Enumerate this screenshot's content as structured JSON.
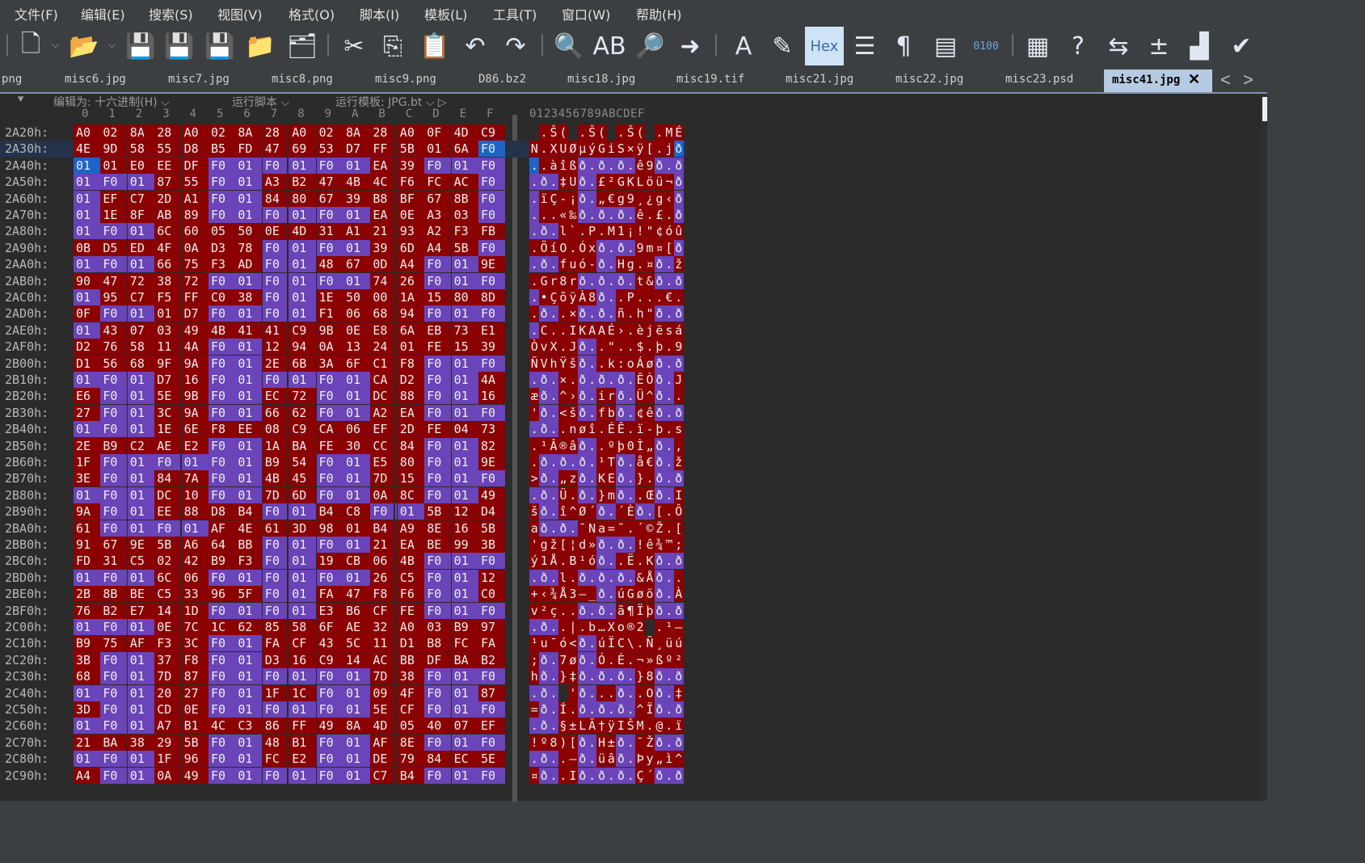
{
  "menu": [
    "文件(F)",
    "编辑(E)",
    "搜索(S)",
    "视图(V)",
    "格式(O)",
    "脚本(I)",
    "模板(L)",
    "工具(T)",
    "窗口(W)",
    "帮助(H)"
  ],
  "toolbar": [
    {
      "name": "new-file-icon",
      "glyph": "🗋"
    },
    {
      "name": "open-folder-icon",
      "glyph": "📂"
    },
    {
      "name": "save-icon",
      "glyph": "💾"
    },
    {
      "name": "save-as-icon",
      "glyph": "💾"
    },
    {
      "name": "save-all-icon",
      "glyph": "💾"
    },
    {
      "name": "folder-icon",
      "glyph": "📁"
    },
    {
      "name": "open-multiple-icon",
      "glyph": "🗂"
    },
    {
      "name": "cut-icon",
      "glyph": "✂"
    },
    {
      "name": "copy-icon",
      "glyph": "⎘"
    },
    {
      "name": "paste-icon",
      "glyph": "📋"
    },
    {
      "name": "undo-icon",
      "glyph": "↶"
    },
    {
      "name": "redo-icon",
      "glyph": "↷"
    },
    {
      "name": "find-icon",
      "glyph": "🔍"
    },
    {
      "name": "replace-icon",
      "glyph": "AB"
    },
    {
      "name": "find-in-files-icon",
      "glyph": "🔎"
    },
    {
      "name": "goto-icon",
      "glyph": "➜"
    },
    {
      "name": "font-icon",
      "glyph": "A"
    },
    {
      "name": "highlight-icon",
      "glyph": "✎"
    },
    {
      "name": "hex-mode-button",
      "glyph": "Hex"
    },
    {
      "name": "edit-mode-icon",
      "glyph": "☰"
    },
    {
      "name": "show-whitespace-icon",
      "glyph": "¶"
    },
    {
      "name": "columns-icon",
      "glyph": "▤"
    },
    {
      "name": "binary-icon",
      "glyph": "0100"
    },
    {
      "name": "calculator-icon",
      "glyph": "▦"
    },
    {
      "name": "help-icon",
      "glyph": "?"
    },
    {
      "name": "compare-icon",
      "glyph": "⇆"
    },
    {
      "name": "add-subtract-icon",
      "glyph": "±"
    },
    {
      "name": "histogram-icon",
      "glyph": "▟"
    },
    {
      "name": "checksum-icon",
      "glyph": "✔"
    }
  ],
  "tabs": [
    "png",
    "misc6.jpg",
    "misc7.jpg",
    "misc8.png",
    "misc9.png",
    "D86.bz2",
    "misc18.jpg",
    "misc19.tif",
    "misc21.jpg",
    "misc22.jpg",
    "misc23.psd",
    "misc41.jpg"
  ],
  "active_tab": "misc41.jpg",
  "tab_close": "✕",
  "tab_nav": [
    "<",
    ">"
  ],
  "options": {
    "edit_as": "编辑为: 十六进制(H)",
    "run_script": "运行脚本",
    "run_template": "运行模板: JPG.bt"
  },
  "column_header": {
    "hex": [
      "0",
      "1",
      "2",
      "3",
      "4",
      "5",
      "6",
      "7",
      "8",
      "9",
      "A",
      "B",
      "C",
      "D",
      "E",
      "F"
    ],
    "ascii": "0123456789ABCDEF"
  },
  "colors": {
    "red": "#8b0000",
    "purple": "#6a44b8",
    "selected": "#1e64c8"
  },
  "rows": [
    {
      "addr": "2A20h:",
      "hex": [
        "A0",
        "02",
        "8A",
        "28",
        "A0",
        "02",
        "8A",
        "28",
        "A0",
        "02",
        "8A",
        "28",
        "A0",
        "0F",
        "4D",
        "C9"
      ],
      "asc": " .Š( .Š( .Š( .MÉ",
      "c": "RRRRRRRRRRRRRRRR",
      "ac": "RRRRRRRRRRRRRRRR"
    },
    {
      "addr": "2A30h:",
      "hex": [
        "4E",
        "9D",
        "58",
        "55",
        "D8",
        "B5",
        "FD",
        "47",
        "69",
        "53",
        "D7",
        "FF",
        "5B",
        "01",
        "6A",
        "F0"
      ],
      "asc": "N.XUØµýGiS×ÿ[.jð",
      "c": "RRRRRRRRRRRRRRRS",
      "ac": "RRRRRRRRRRRRRRRS"
    },
    {
      "addr": "2A40h:",
      "hex": [
        "01",
        "01",
        "E0",
        "EE",
        "DF",
        "F0",
        "01",
        "F0",
        "01",
        "F0",
        "01",
        "EA",
        "39",
        "F0",
        "01",
        "F0"
      ],
      "asc": "..àîßð.ð.ð.ê9ð.ð",
      "c": "SRRRRPPPPPPRRPPP",
      "ac": "SRRRRPPPPPPRRPPP"
    },
    {
      "addr": "2A50h:",
      "hex": [
        "01",
        "F0",
        "01",
        "87",
        "55",
        "F0",
        "01",
        "A3",
        "B2",
        "47",
        "4B",
        "4C",
        "F6",
        "FC",
        "AC",
        "F0"
      ],
      "asc": ".ð.‡Uð.£²GKLöü¬ð",
      "c": "PPPRRPPRRRRRRRRP",
      "ac": "PPPRRPPRRRRRRRRP"
    },
    {
      "addr": "2A60h:",
      "hex": [
        "01",
        "EF",
        "C7",
        "2D",
        "A1",
        "F0",
        "01",
        "84",
        "80",
        "67",
        "39",
        "B8",
        "BF",
        "67",
        "8B",
        "F0"
      ],
      "asc": ".ïÇ-¡ð.„€g9¸¿g‹ð",
      "c": "PRRRRPPRRRRRRRRP",
      "ac": "PRRRRPPRRRRRRRRP"
    },
    {
      "addr": "2A70h:",
      "hex": [
        "01",
        "1E",
        "8F",
        "AB",
        "89",
        "F0",
        "01",
        "F0",
        "01",
        "F0",
        "01",
        "EA",
        "0E",
        "A3",
        "03",
        "F0"
      ],
      "asc": "...«‰ð.ð.ð.ê.£.ð",
      "c": "PRRRRPPPPPPRRRRP",
      "ac": "PRRRRPPPPPPRRRRP"
    },
    {
      "addr": "2A80h:",
      "hex": [
        "01",
        "F0",
        "01",
        "6C",
        "60",
        "05",
        "50",
        "0E",
        "4D",
        "31",
        "A1",
        "21",
        "93",
        "A2",
        "F3",
        "FB"
      ],
      "asc": ".ð.l`.P.M1¡!\"¢óû",
      "c": "PPPRRRRRRRRRRRRR",
      "ac": "PPPRRRRRRRRRRRRR"
    },
    {
      "addr": "2A90h:",
      "hex": [
        "0B",
        "D5",
        "ED",
        "4F",
        "0A",
        "D3",
        "78",
        "F0",
        "01",
        "F0",
        "01",
        "39",
        "6D",
        "A4",
        "5B",
        "F0"
      ],
      "asc": ".ÕíO.Óxð.ð.9m¤[ð",
      "c": "RRRRRRRPPPPRRRRP",
      "ac": "RRRRRRRPPPPRRRRP"
    },
    {
      "addr": "2AA0h:",
      "hex": [
        "01",
        "F0",
        "01",
        "66",
        "75",
        "F3",
        "AD",
        "F0",
        "01",
        "48",
        "67",
        "0D",
        "A4",
        "F0",
        "01",
        "9E"
      ],
      "asc": ".ð.fuó-ð.Hg.¤ð.ž",
      "c": "PPPRRRRPPRRRRPPR",
      "ac": "PPPRRRRPPRRRRPPR"
    },
    {
      "addr": "2AB0h:",
      "hex": [
        "90",
        "47",
        "72",
        "38",
        "72",
        "F0",
        "01",
        "F0",
        "01",
        "F0",
        "01",
        "74",
        "26",
        "F0",
        "01",
        "F0"
      ],
      "asc": ".Gr8rð.ð.ð.t&ð.ð",
      "c": "RRRRRPPPPPPRRPPP",
      "ac": "RRRRRPPPPPPRRPPP"
    },
    {
      "addr": "2AC0h:",
      "hex": [
        "01",
        "95",
        "C7",
        "F5",
        "FF",
        "C0",
        "38",
        "F0",
        "01",
        "1E",
        "50",
        "00",
        "1A",
        "15",
        "80",
        "8D"
      ],
      "asc": ".•ÇõÿÀ8ð..P...€.",
      "c": "PRRRRRRPPRRRRRRR",
      "ac": "PRRRRRRPPRRRRRRR"
    },
    {
      "addr": "2AD0h:",
      "hex": [
        "0F",
        "F0",
        "01",
        "01",
        "D7",
        "F0",
        "01",
        "F0",
        "01",
        "F1",
        "06",
        "68",
        "94",
        "F0",
        "01",
        "F0"
      ],
      "asc": ".ð..×ð.ð.ñ.h\"ð.ð",
      "c": "RPPRRPPPPRRRRPPP",
      "ac": "RPPRRPPPPRRRRPPP"
    },
    {
      "addr": "2AE0h:",
      "hex": [
        "01",
        "43",
        "07",
        "03",
        "49",
        "4B",
        "41",
        "41",
        "C9",
        "9B",
        "0E",
        "E8",
        "6A",
        "EB",
        "73",
        "E1"
      ],
      "asc": ".C..IKAAÉ›.èjësá",
      "c": "PRRRRRRRRRRRRRRR",
      "ac": "PRRRRRRRRRRRRRRR"
    },
    {
      "addr": "2AF0h:",
      "hex": [
        "D2",
        "76",
        "58",
        "11",
        "4A",
        "F0",
        "01",
        "12",
        "94",
        "0A",
        "13",
        "24",
        "01",
        "FE",
        "15",
        "39"
      ],
      "asc": "ÒvX.Jð..\"..$.þ.9",
      "c": "RRRRRPPRRRRRRRRR",
      "ac": "RRRRRPPRRRRRRRRR"
    },
    {
      "addr": "2B00h:",
      "hex": [
        "D1",
        "56",
        "68",
        "9F",
        "9A",
        "F0",
        "01",
        "2E",
        "6B",
        "3A",
        "6F",
        "C1",
        "F8",
        "F0",
        "01",
        "F0"
      ],
      "asc": "ÑVhŸšð..k:oÁøð.ð",
      "c": "RRRRRPPRRRRRRPPP",
      "ac": "RRRRRPPRRRRRRPPP"
    },
    {
      "addr": "2B10h:",
      "hex": [
        "01",
        "F0",
        "01",
        "D7",
        "16",
        "F0",
        "01",
        "F0",
        "01",
        "F0",
        "01",
        "CA",
        "D2",
        "F0",
        "01",
        "4A"
      ],
      "asc": ".ð.×.ð.ð.ð.ÊÒð.J",
      "c": "PPPRRPPPPPPRRPPR",
      "ac": "PPPRRPPPPPPRRPPR"
    },
    {
      "addr": "2B20h:",
      "hex": [
        "E6",
        "F0",
        "01",
        "5E",
        "9B",
        "F0",
        "01",
        "EC",
        "72",
        "F0",
        "01",
        "DC",
        "88",
        "F0",
        "01",
        "16"
      ],
      "asc": "æð.^›ð.irð.Ü^ð..",
      "c": "RPPRRPPRRPPRRPPR",
      "ac": "RPPRRPPRRPPRRPPR"
    },
    {
      "addr": "2B30h:",
      "hex": [
        "27",
        "F0",
        "01",
        "3C",
        "9A",
        "F0",
        "01",
        "66",
        "62",
        "F0",
        "01",
        "A2",
        "EA",
        "F0",
        "01",
        "F0"
      ],
      "asc": "'ð.<šð.fbð.¢êð.ð",
      "c": "RPPRRPPRRPPRRPPP",
      "ac": "RPPRRPPRRPPRRPPP"
    },
    {
      "addr": "2B40h:",
      "hex": [
        "01",
        "F0",
        "01",
        "1E",
        "6E",
        "F8",
        "EE",
        "08",
        "C9",
        "CA",
        "06",
        "EF",
        "2D",
        "FE",
        "04",
        "73"
      ],
      "asc": ".ð..nøî.ÉÊ.ï-þ.s",
      "c": "PPPRRRRRRRRRRRRR",
      "ac": "PPPRRRRRRRRRRRRR"
    },
    {
      "addr": "2B50h:",
      "hex": [
        "2E",
        "B9",
        "C2",
        "AE",
        "E2",
        "F0",
        "01",
        "1A",
        "BA",
        "FE",
        "30",
        "CC",
        "84",
        "F0",
        "01",
        "82"
      ],
      "asc": ".¹Â®âð..ºþ0Ì„ð.,",
      "c": "RRRRRPPRRRRRRPPR",
      "ac": "RRRRRPPRRRRRRPPR"
    },
    {
      "addr": "2B60h:",
      "hex": [
        "1F",
        "F0",
        "01",
        "F0",
        "01",
        "F0",
        "01",
        "B9",
        "54",
        "F0",
        "01",
        "E5",
        "80",
        "F0",
        "01",
        "9E"
      ],
      "asc": ".ð.ð.ð.¹Tð.å€ð.ž",
      "c": "RPPPPPPRRPPRRPPR",
      "ac": "RPPPPPPRRPPRRPPR"
    },
    {
      "addr": "2B70h:",
      "hex": [
        "3E",
        "F0",
        "01",
        "84",
        "7A",
        "F0",
        "01",
        "4B",
        "45",
        "F0",
        "01",
        "7D",
        "15",
        "F0",
        "01",
        "F0"
      ],
      "asc": ">ð.„zð.KEð.}.ð.ð",
      "c": "RPPRRPPRRPPRRPPP",
      "ac": "RPPRRPPRRPPRRPPP"
    },
    {
      "addr": "2B80h:",
      "hex": [
        "01",
        "F0",
        "01",
        "DC",
        "10",
        "F0",
        "01",
        "7D",
        "6D",
        "F0",
        "01",
        "0A",
        "8C",
        "F0",
        "01",
        "49"
      ],
      "asc": ".ð.Ü.ð.}mð..Œð.I",
      "c": "PPPRRPPRRPPRRPPR",
      "ac": "PPPRRPPRRPPRRPPR"
    },
    {
      "addr": "2B90h:",
      "hex": [
        "9A",
        "F0",
        "01",
        "EE",
        "88",
        "D8",
        "B4",
        "F0",
        "01",
        "B4",
        "C8",
        "F0",
        "01",
        "5B",
        "12",
        "D4"
      ],
      "asc": "šð.î^Ø´ð.´Èð.[.Ô",
      "c": "RPPRRRRPPRRPPRRR",
      "ac": "RPPRRRRPPRRPPRRR"
    },
    {
      "addr": "2BA0h:",
      "hex": [
        "61",
        "F0",
        "01",
        "F0",
        "01",
        "AF",
        "4E",
        "61",
        "3D",
        "98",
        "01",
        "B4",
        "A9",
        "8E",
        "16",
        "5B"
      ],
      "asc": "að.ð.¯Na=˜.´©Ž.[",
      "c": "RPPPPRRRRRRRRRRR",
      "ac": "RPPPPRRRRRRRRRRR"
    },
    {
      "addr": "2BB0h:",
      "hex": [
        "91",
        "67",
        "9E",
        "5B",
        "A6",
        "64",
        "BB",
        "F0",
        "01",
        "F0",
        "01",
        "21",
        "EA",
        "BE",
        "99",
        "3B"
      ],
      "asc": "'gž[¦d»ð.ð.!ê¾™;",
      "c": "RRRRRRRPPPPRRRRR",
      "ac": "RRRRRRRPPPPRRRRR"
    },
    {
      "addr": "2BC0h:",
      "hex": [
        "FD",
        "31",
        "C5",
        "02",
        "42",
        "B9",
        "F3",
        "F0",
        "01",
        "19",
        "CB",
        "06",
        "4B",
        "F0",
        "01",
        "F0"
      ],
      "asc": "ý1Å.B¹óð..Ë.Kð.ð",
      "c": "RRRRRRRPPRRRRPPP",
      "ac": "RRRRRRRPPRRRRPPP"
    },
    {
      "addr": "2BD0h:",
      "hex": [
        "01",
        "F0",
        "01",
        "6C",
        "06",
        "F0",
        "01",
        "F0",
        "01",
        "F0",
        "01",
        "26",
        "C5",
        "F0",
        "01",
        "12"
      ],
      "asc": ".ð.l.ð.ð.ð.&Åð..",
      "c": "PPPRRPPPPPPRRPPR",
      "ac": "PPPRRPPPPPPRRPPR"
    },
    {
      "addr": "2BE0h:",
      "hex": [
        "2B",
        "8B",
        "BE",
        "C5",
        "33",
        "96",
        "5F",
        "F0",
        "01",
        "FA",
        "47",
        "F8",
        "F6",
        "F0",
        "01",
        "C0"
      ],
      "asc": "+‹¾Å3–_ð.úGøöð.À",
      "c": "RRRRRRRPPRRRRPPR",
      "ac": "RRRRRRRPPRRRRPPR"
    },
    {
      "addr": "2BF0h:",
      "hex": [
        "76",
        "B2",
        "E7",
        "14",
        "1D",
        "F0",
        "01",
        "F0",
        "01",
        "E3",
        "B6",
        "CF",
        "FE",
        "F0",
        "01",
        "F0"
      ],
      "asc": "v²ç..ð.ð.ã¶Ïþð.ð",
      "c": "RRRRRPPPPRRRRPPP",
      "ac": "RRRRRPPPPRRRRPPP"
    },
    {
      "addr": "2C00h:",
      "hex": [
        "01",
        "F0",
        "01",
        "0E",
        "7C",
        "1C",
        "62",
        "85",
        "58",
        "6F",
        "AE",
        "32",
        "A0",
        "03",
        "B9",
        "97"
      ],
      "asc": ".ð..|.b…Xo®2 .¹—",
      "c": "PPPRRRRRRRRRRRRR",
      "ac": "PPPRRRRRRRRRRRRR"
    },
    {
      "addr": "2C10h:",
      "hex": [
        "B9",
        "75",
        "AF",
        "F3",
        "3C",
        "F0",
        "01",
        "FA",
        "CF",
        "43",
        "5C",
        "11",
        "D1",
        "B8",
        "FC",
        "FA"
      ],
      "asc": "¹u¯ó<ð.úÏC\\.Ñ¸üú",
      "c": "RRRRRPPRRRRRRRRR",
      "ac": "RRRRRPPRRRRRRRRR"
    },
    {
      "addr": "2C20h:",
      "hex": [
        "3B",
        "F0",
        "01",
        "37",
        "F8",
        "F0",
        "01",
        "D3",
        "16",
        "C9",
        "14",
        "AC",
        "BB",
        "DF",
        "BA",
        "B2"
      ],
      "asc": ";ð.7øð.Ó.É.¬»ßº²",
      "c": "RPPRRPPRRRRRRRRR",
      "ac": "RPPRRPPRRRRRRRRR"
    },
    {
      "addr": "2C30h:",
      "hex": [
        "68",
        "F0",
        "01",
        "7D",
        "87",
        "F0",
        "01",
        "F0",
        "01",
        "F0",
        "01",
        "7D",
        "38",
        "F0",
        "01",
        "F0"
      ],
      "asc": "hð.}‡ð.ð.ð.}8ð.ð",
      "c": "RPPRRPPPPPPRRPPP",
      "ac": "RPPRRPPPPPPRRPPP"
    },
    {
      "addr": "2C40h:",
      "hex": [
        "01",
        "F0",
        "01",
        "20",
        "27",
        "F0",
        "01",
        "1F",
        "1C",
        "F0",
        "01",
        "09",
        "4F",
        "F0",
        "01",
        "87"
      ],
      "asc": ".ð. 'ð...ð..Oð.‡",
      "c": "PPPRRPPRRPPRRPPR",
      "ac": "PPPRRPPRRPPRRPPR"
    },
    {
      "addr": "2C50h:",
      "hex": [
        "3D",
        "F0",
        "01",
        "CD",
        "0E",
        "F0",
        "01",
        "F0",
        "01",
        "F0",
        "01",
        "5E",
        "CF",
        "F0",
        "01",
        "F0"
      ],
      "asc": "=ð.Í.ð.ð.ð.^Ïð.ð",
      "c": "RPPRRPPPPPPRRPPP",
      "ac": "RPPRRPPPPPPRRPPP"
    },
    {
      "addr": "2C60h:",
      "hex": [
        "01",
        "F0",
        "01",
        "A7",
        "B1",
        "4C",
        "C3",
        "86",
        "FF",
        "49",
        "8A",
        "4D",
        "05",
        "40",
        "07",
        "EF"
      ],
      "asc": ".ð.§±LÃ†ÿIŠM.@.ï",
      "c": "PPPRRRRRRRRRRRRR",
      "ac": "PPPRRRRRRRRRRRRR"
    },
    {
      "addr": "2C70h:",
      "hex": [
        "21",
        "BA",
        "38",
        "29",
        "5B",
        "F0",
        "01",
        "48",
        "B1",
        "F0",
        "01",
        "AF",
        "8E",
        "F0",
        "01",
        "F0"
      ],
      "asc": "!º8)[ð.H±ð.¯Žð.ð",
      "c": "RRRRRPPRRPPRRPPP",
      "ac": "RRRRRPPRRPPRRPPP"
    },
    {
      "addr": "2C80h:",
      "hex": [
        "01",
        "F0",
        "01",
        "1F",
        "96",
        "F0",
        "01",
        "FC",
        "E2",
        "F0",
        "01",
        "DE",
        "79",
        "84",
        "EC",
        "5E"
      ],
      "asc": ".ð..–ð.üâð.Þy„ì^",
      "c": "PPPRRPPRRPPRRRRR",
      "ac": "PPPRRPPRRPPRRRRR"
    },
    {
      "addr": "2C90h:",
      "hex": [
        "A4",
        "F0",
        "01",
        "0A",
        "49",
        "F0",
        "01",
        "F0",
        "01",
        "F0",
        "01",
        "C7",
        "B4",
        "F0",
        "01",
        "F0"
      ],
      "asc": "¤ð..Ið.ð.ð.Ç´ð.ð",
      "c": "RPPRRPPPPPPRRPPP",
      "ac": "RPPRRPPPPPPRRPPP"
    }
  ]
}
